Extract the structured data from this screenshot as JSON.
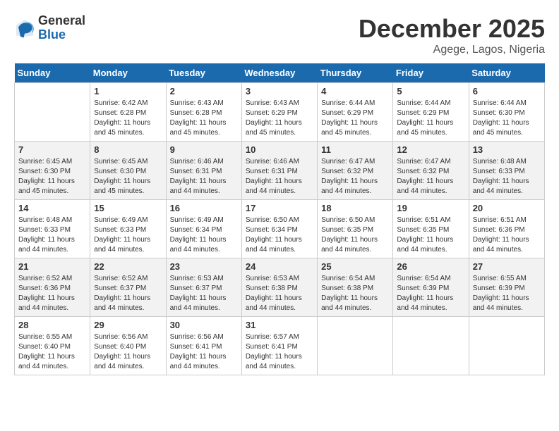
{
  "header": {
    "logo_general": "General",
    "logo_blue": "Blue",
    "month_title": "December 2025",
    "location": "Agege, Lagos, Nigeria"
  },
  "days_of_week": [
    "Sunday",
    "Monday",
    "Tuesday",
    "Wednesday",
    "Thursday",
    "Friday",
    "Saturday"
  ],
  "weeks": [
    [
      {
        "day": "",
        "info": ""
      },
      {
        "day": "1",
        "info": "Sunrise: 6:42 AM\nSunset: 6:28 PM\nDaylight: 11 hours\nand 45 minutes."
      },
      {
        "day": "2",
        "info": "Sunrise: 6:43 AM\nSunset: 6:28 PM\nDaylight: 11 hours\nand 45 minutes."
      },
      {
        "day": "3",
        "info": "Sunrise: 6:43 AM\nSunset: 6:29 PM\nDaylight: 11 hours\nand 45 minutes."
      },
      {
        "day": "4",
        "info": "Sunrise: 6:44 AM\nSunset: 6:29 PM\nDaylight: 11 hours\nand 45 minutes."
      },
      {
        "day": "5",
        "info": "Sunrise: 6:44 AM\nSunset: 6:29 PM\nDaylight: 11 hours\nand 45 minutes."
      },
      {
        "day": "6",
        "info": "Sunrise: 6:44 AM\nSunset: 6:30 PM\nDaylight: 11 hours\nand 45 minutes."
      }
    ],
    [
      {
        "day": "7",
        "info": "Sunrise: 6:45 AM\nSunset: 6:30 PM\nDaylight: 11 hours\nand 45 minutes."
      },
      {
        "day": "8",
        "info": "Sunrise: 6:45 AM\nSunset: 6:30 PM\nDaylight: 11 hours\nand 45 minutes."
      },
      {
        "day": "9",
        "info": "Sunrise: 6:46 AM\nSunset: 6:31 PM\nDaylight: 11 hours\nand 44 minutes."
      },
      {
        "day": "10",
        "info": "Sunrise: 6:46 AM\nSunset: 6:31 PM\nDaylight: 11 hours\nand 44 minutes."
      },
      {
        "day": "11",
        "info": "Sunrise: 6:47 AM\nSunset: 6:32 PM\nDaylight: 11 hours\nand 44 minutes."
      },
      {
        "day": "12",
        "info": "Sunrise: 6:47 AM\nSunset: 6:32 PM\nDaylight: 11 hours\nand 44 minutes."
      },
      {
        "day": "13",
        "info": "Sunrise: 6:48 AM\nSunset: 6:33 PM\nDaylight: 11 hours\nand 44 minutes."
      }
    ],
    [
      {
        "day": "14",
        "info": "Sunrise: 6:48 AM\nSunset: 6:33 PM\nDaylight: 11 hours\nand 44 minutes."
      },
      {
        "day": "15",
        "info": "Sunrise: 6:49 AM\nSunset: 6:33 PM\nDaylight: 11 hours\nand 44 minutes."
      },
      {
        "day": "16",
        "info": "Sunrise: 6:49 AM\nSunset: 6:34 PM\nDaylight: 11 hours\nand 44 minutes."
      },
      {
        "day": "17",
        "info": "Sunrise: 6:50 AM\nSunset: 6:34 PM\nDaylight: 11 hours\nand 44 minutes."
      },
      {
        "day": "18",
        "info": "Sunrise: 6:50 AM\nSunset: 6:35 PM\nDaylight: 11 hours\nand 44 minutes."
      },
      {
        "day": "19",
        "info": "Sunrise: 6:51 AM\nSunset: 6:35 PM\nDaylight: 11 hours\nand 44 minutes."
      },
      {
        "day": "20",
        "info": "Sunrise: 6:51 AM\nSunset: 6:36 PM\nDaylight: 11 hours\nand 44 minutes."
      }
    ],
    [
      {
        "day": "21",
        "info": "Sunrise: 6:52 AM\nSunset: 6:36 PM\nDaylight: 11 hours\nand 44 minutes."
      },
      {
        "day": "22",
        "info": "Sunrise: 6:52 AM\nSunset: 6:37 PM\nDaylight: 11 hours\nand 44 minutes."
      },
      {
        "day": "23",
        "info": "Sunrise: 6:53 AM\nSunset: 6:37 PM\nDaylight: 11 hours\nand 44 minutes."
      },
      {
        "day": "24",
        "info": "Sunrise: 6:53 AM\nSunset: 6:38 PM\nDaylight: 11 hours\nand 44 minutes."
      },
      {
        "day": "25",
        "info": "Sunrise: 6:54 AM\nSunset: 6:38 PM\nDaylight: 11 hours\nand 44 minutes."
      },
      {
        "day": "26",
        "info": "Sunrise: 6:54 AM\nSunset: 6:39 PM\nDaylight: 11 hours\nand 44 minutes."
      },
      {
        "day": "27",
        "info": "Sunrise: 6:55 AM\nSunset: 6:39 PM\nDaylight: 11 hours\nand 44 minutes."
      }
    ],
    [
      {
        "day": "28",
        "info": "Sunrise: 6:55 AM\nSunset: 6:40 PM\nDaylight: 11 hours\nand 44 minutes."
      },
      {
        "day": "29",
        "info": "Sunrise: 6:56 AM\nSunset: 6:40 PM\nDaylight: 11 hours\nand 44 minutes."
      },
      {
        "day": "30",
        "info": "Sunrise: 6:56 AM\nSunset: 6:41 PM\nDaylight: 11 hours\nand 44 minutes."
      },
      {
        "day": "31",
        "info": "Sunrise: 6:57 AM\nSunset: 6:41 PM\nDaylight: 11 hours\nand 44 minutes."
      },
      {
        "day": "",
        "info": ""
      },
      {
        "day": "",
        "info": ""
      },
      {
        "day": "",
        "info": ""
      }
    ]
  ]
}
